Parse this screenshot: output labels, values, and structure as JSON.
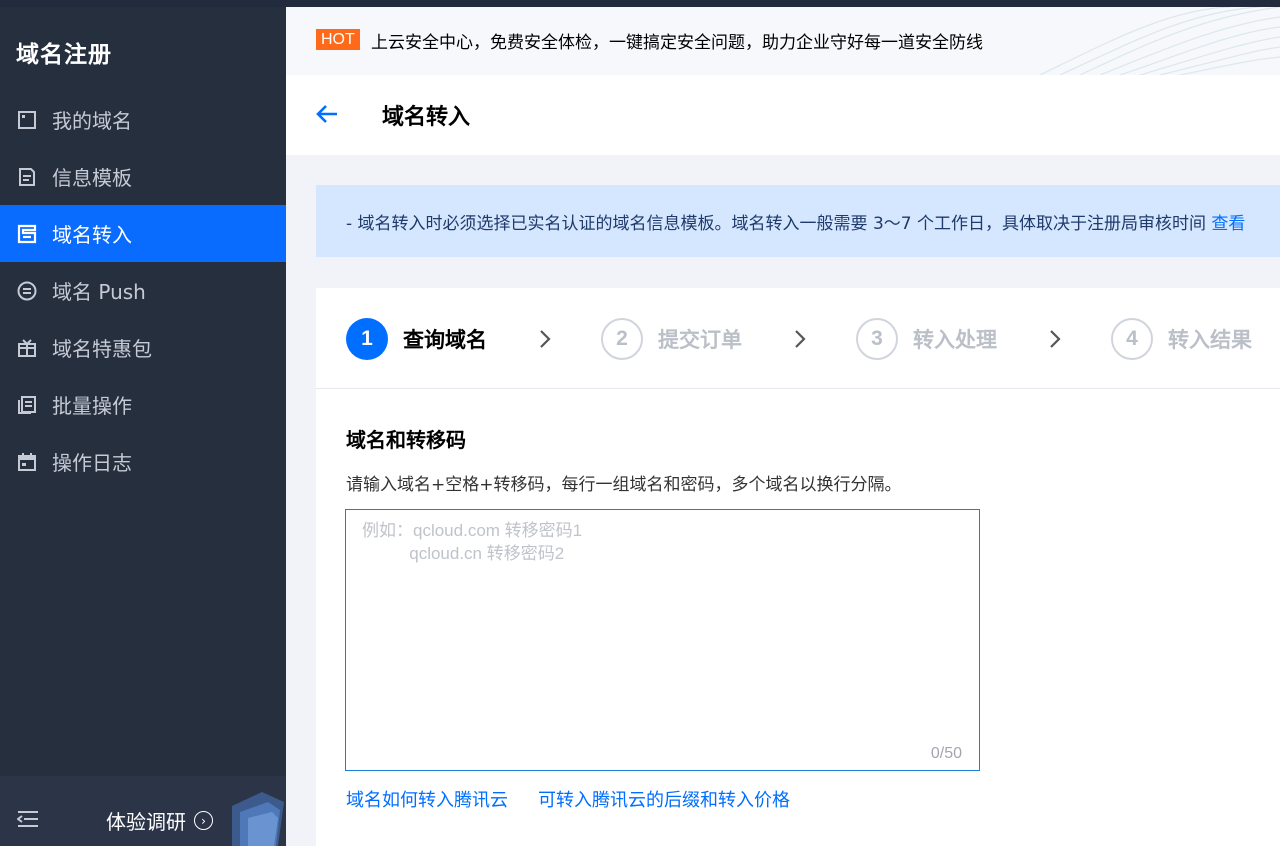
{
  "sidebar": {
    "title": "域名注册",
    "items": [
      {
        "label": "我的域名",
        "icon": "calendar-icon",
        "active": false
      },
      {
        "label": "信息模板",
        "icon": "document-icon",
        "active": false
      },
      {
        "label": "域名转入",
        "icon": "transfer-icon",
        "active": true
      },
      {
        "label": "域名 Push",
        "icon": "push-icon",
        "active": false
      },
      {
        "label": "域名特惠包",
        "icon": "gift-icon",
        "active": false
      },
      {
        "label": "批量操作",
        "icon": "batch-icon",
        "active": false
      },
      {
        "label": "操作日志",
        "icon": "log-icon",
        "active": false
      }
    ],
    "footer": {
      "survey_label": "体验调研"
    }
  },
  "banner": {
    "badge": "HOT",
    "text": "上云安全中心，免费安全体检，一键搞定安全问题，助力企业守好每一道安全防线"
  },
  "header": {
    "title": "域名转入"
  },
  "notice": {
    "text": "- 域名转入时必须选择已实名认证的域名信息模板。域名转入一般需要 3～7 个工作日，具体取决于注册局审核时间",
    "link": "查看"
  },
  "steps": [
    {
      "num": "1",
      "label": "查询域名",
      "active": true
    },
    {
      "num": "2",
      "label": "提交订单",
      "active": false
    },
    {
      "num": "3",
      "label": "转入处理",
      "active": false
    },
    {
      "num": "4",
      "label": "转入结果",
      "active": false
    }
  ],
  "form": {
    "section_title": "域名和转移码",
    "description": "请输入域名+空格+转移码，每行一组域名和密码，多个域名以换行分隔。",
    "placeholder": "例如：qcloud.com 转移密码1\n          qcloud.cn 转移密码2",
    "counter": "0/50",
    "links": [
      "域名如何转入腾讯云",
      "可转入腾讯云的后缀和转入价格"
    ]
  },
  "colors": {
    "sidebar_bg": "#262f3e",
    "accent": "#006eff",
    "hot_badge": "#ff6a1a",
    "notice_bg": "#d5e7ff"
  }
}
